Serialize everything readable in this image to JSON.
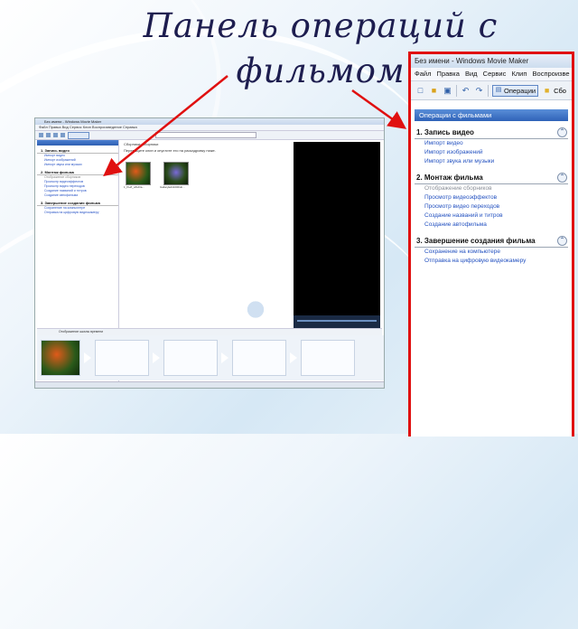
{
  "slide": {
    "title": "Панель операций с фильмом",
    "colors": {
      "title": "#1d1d4f",
      "arrow": "#e01010",
      "highlight": "#e01010"
    }
  },
  "mini_screenshot": {
    "window_title": "Без имени - Windows Movie Maker",
    "menu": "Файл  Правка  Вид  Сервис  Клип  Воспроизведение  Справка",
    "panel_header": "Операции с фильмами",
    "sections": [
      {
        "title": "1. Запись видео",
        "links": [
          "Импорт видео",
          "Импорт изображений",
          "Импорт звука или музыки"
        ]
      },
      {
        "title": "2. Монтаж фильма",
        "links": [
          "Отображение сборников",
          "Просмотр видеоэффектов",
          "Просмотр видео переходов",
          "Создание названий и титров",
          "Создание автофильма"
        ]
      },
      {
        "title": "3. Завершение создания фильма",
        "links": [
          "Сохранение на компьютере",
          "Отправка на цифровую видеокамеру"
        ]
      }
    ],
    "collection_title": "Сборники: Сборники",
    "collection_hint": "Перетащите клип и опустите его на раскадровку ниже.",
    "clips": [
      "1_Рыб_обНОа...",
      "GallaryEdit100Rub..."
    ],
    "storyboard_label": "Отображение шкалы времени"
  },
  "zoom": {
    "window_title": "Без имени - Windows Movie Maker",
    "menu": [
      "Файл",
      "Правка",
      "Вид",
      "Сервис",
      "Клип",
      "Воспроизве"
    ],
    "toolbar": {
      "operations_button": "Операции",
      "collections_button": "Сбо"
    },
    "panel_header": "Операции с фильмами",
    "sections": [
      {
        "title": "1. Запись видео",
        "links": [
          "Импорт видео",
          "Импорт изображений",
          "Импорт звука или музыки"
        ]
      },
      {
        "title": "2. Монтаж фильма",
        "links": [
          "Отображение сборников",
          "Просмотр видеоэффектов",
          "Просмотр видео переходов",
          "Создание названий и титров",
          "Создание автофильма"
        ]
      },
      {
        "title": "3. Завершение создания фильма",
        "links": [
          "Сохранение на компьютере",
          "Отправка на цифровую видеокамеру"
        ]
      }
    ],
    "icons": [
      "new-project-icon",
      "open-icon",
      "save-icon",
      "undo-icon",
      "redo-icon",
      "operations-icon",
      "collections-icon",
      "collapse-icon"
    ]
  }
}
